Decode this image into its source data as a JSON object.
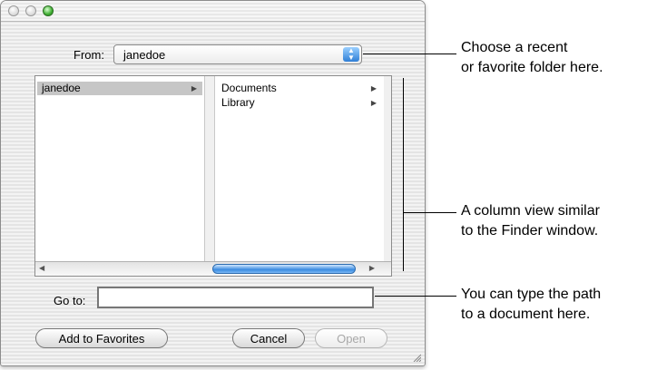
{
  "dialog": {
    "from_label": "From:",
    "from_value": "janedoe",
    "columns": [
      {
        "items": [
          {
            "label": "janedoe",
            "selected": true,
            "has_children": true
          }
        ]
      },
      {
        "items": [
          {
            "label": "Documents",
            "selected": false,
            "has_children": true
          },
          {
            "label": "Library",
            "selected": false,
            "has_children": true
          }
        ]
      }
    ],
    "goto_label": "Go to:",
    "goto_value": "",
    "buttons": {
      "add_favorites": "Add to Favorites",
      "cancel": "Cancel",
      "open": "Open"
    }
  },
  "callouts": [
    {
      "line1": "Choose a recent",
      "line2": "or favorite folder here."
    },
    {
      "line1": "A column view similar",
      "line2": "to the Finder window."
    },
    {
      "line1": "You can type the path",
      "line2": "to a document here."
    }
  ],
  "colors": {
    "selection": "#c6c6c6",
    "scroll_thumb": "#3a8be0",
    "zoom_button": "#3fae32"
  }
}
